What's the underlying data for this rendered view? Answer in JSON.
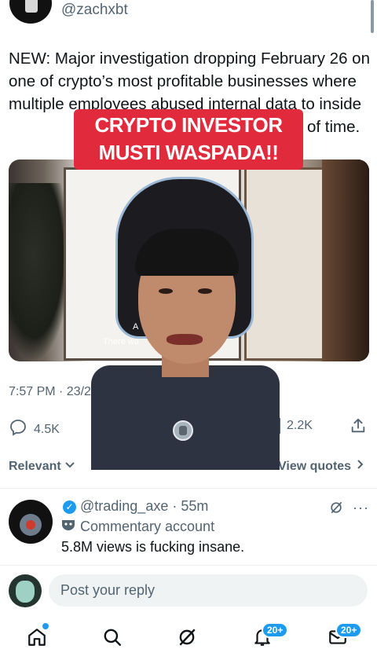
{
  "header": {
    "handle": "@zachxbt"
  },
  "tweet": {
    "text": "NEW: Major investigation dropping February 26 on one of crypto’s most profitable businesses where multiple employees abused internal data to inside",
    "text_tail": "of time.",
    "timestamp": "7:57 PM · 23/2/26",
    "replies_count": "4.5K",
    "views_count": "2.2K"
  },
  "video": {
    "subtitle_top": "A",
    "subtitle": "There wa"
  },
  "overlay_banner": {
    "line1": "CRYPTO INVESTOR",
    "line2": "MUSTI WASPADA!!"
  },
  "sort": {
    "relevant_label": "Relevant",
    "quotes_label": "View quotes"
  },
  "reply": {
    "handle_time": "@trading_axe · 55m",
    "account_label": "Commentary account",
    "text": "5.8M views is fucking insane."
  },
  "composer": {
    "placeholder": "Post your reply"
  },
  "bottom_nav": {
    "items": [
      "home",
      "search",
      "grok",
      "notifications",
      "messages"
    ],
    "notifications_badge": "20+",
    "messages_badge": "20+"
  },
  "colors": {
    "accent": "#1d9bf0",
    "banner": "#e12b3d",
    "muted_text": "#536471"
  }
}
